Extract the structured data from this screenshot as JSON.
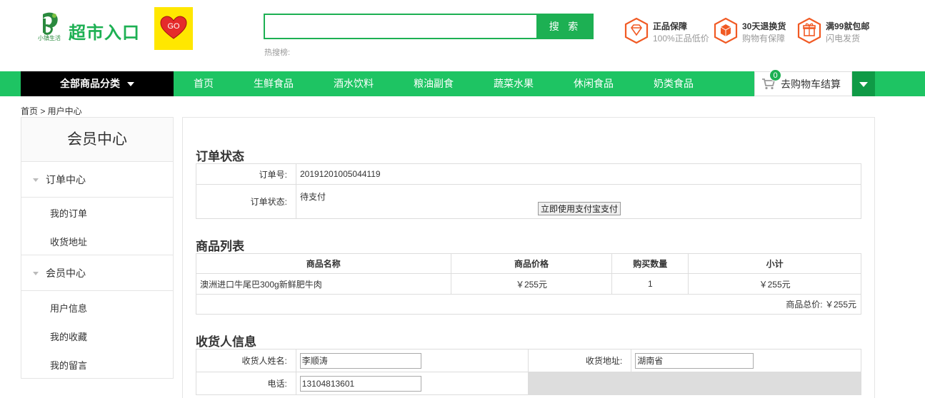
{
  "header": {
    "logo_small_text": "小镇生活",
    "brand_text": "超市入口",
    "go_badge_text": "GO",
    "search_placeholder": "",
    "search_button": "搜 索",
    "hot_search_label": "热搜榜:",
    "promises": [
      {
        "title": "正品保障",
        "subtitle": "100%正品低价"
      },
      {
        "title": "30天退换货",
        "subtitle": "购物有保障"
      },
      {
        "title": "满99就包邮",
        "subtitle": "闪电发货"
      }
    ]
  },
  "nav": {
    "all_categories": "全部商品分类",
    "items": [
      "首页",
      "生鲜食品",
      "酒水饮料",
      "粮油副食",
      "蔬菜水果",
      "休闲食品",
      "奶类食品"
    ],
    "cart_label": "去购物车结算",
    "cart_count": "0"
  },
  "breadcrumb": "首页 > 用户中心",
  "sidebar": {
    "title": "会员中心",
    "groups": [
      {
        "label": "订单中心",
        "links": [
          "我的订单",
          "收货地址"
        ]
      },
      {
        "label": "会员中心",
        "links": [
          "用户信息",
          "我的收藏",
          "我的留言"
        ]
      }
    ]
  },
  "order_status": {
    "section_title": "订单状态",
    "order_no_label": "订单号:",
    "order_no": "20191201005044119",
    "status_label": "订单状态:",
    "status_value": "待支付",
    "pay_button": "立即使用支付宝支付"
  },
  "goods": {
    "section_title": "商品列表",
    "columns": [
      "商品名称",
      "商品价格",
      "购买数量",
      "小计"
    ],
    "rows": [
      {
        "name": "澳洲进口牛尾巴300g新鲜肥牛肉",
        "price": "￥255元",
        "qty": "1",
        "subtotal": "￥255元"
      }
    ],
    "total_text": "商品总价: ￥255元"
  },
  "receiver": {
    "section_title": "收货人信息",
    "name_label": "收货人姓名:",
    "name_value": "李顺涛",
    "address_label": "收货地址:",
    "address_value": "湖南省",
    "phone_label": "电话:",
    "phone_value": "13104813601"
  },
  "colors": {
    "brand_green": "#1db053",
    "nav_green": "#1ec463",
    "accent_orange": "#f15a24"
  }
}
